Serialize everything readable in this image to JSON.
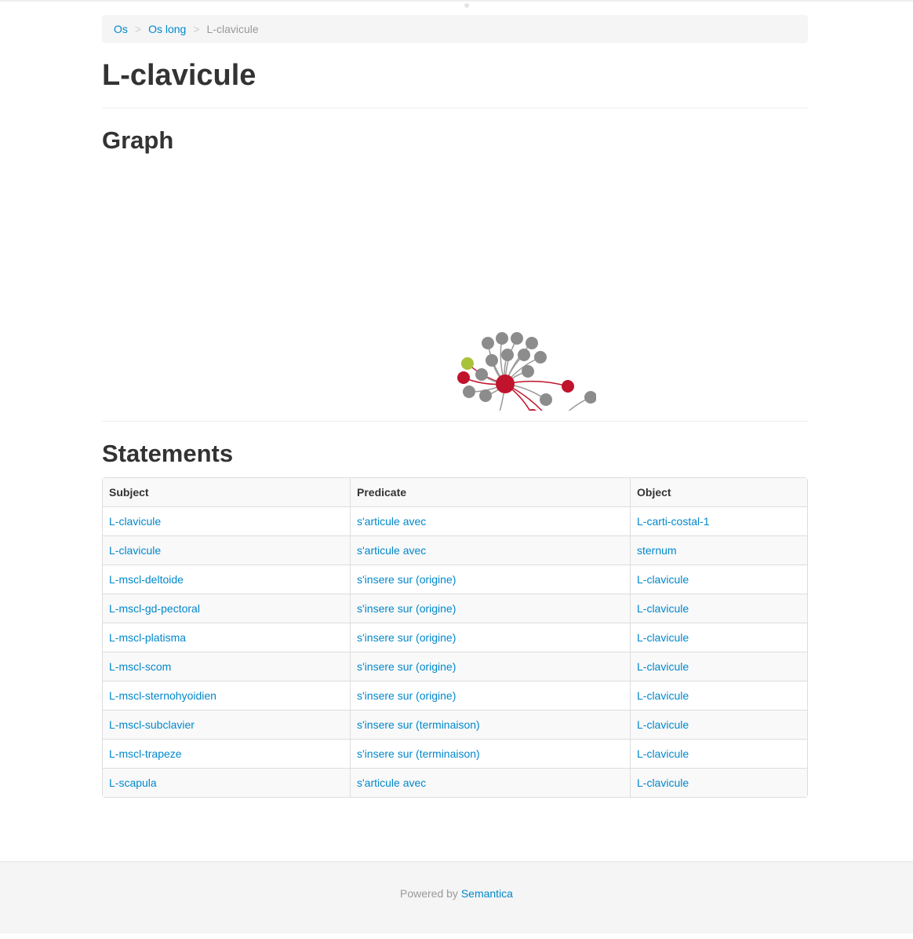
{
  "breadcrumb": {
    "items": [
      "Os",
      "Os long"
    ],
    "separator": ">",
    "current": "L-clavicule"
  },
  "page_title": "L-clavicule",
  "graph": {
    "title": "Graph",
    "colors": {
      "red": "#c0132c",
      "grey": "#8c8c8c",
      "yellow": "#cfbf3a",
      "lime": "#a8c23a",
      "black": "#000000",
      "pink": "#d93a5a"
    }
  },
  "statements": {
    "title": "Statements",
    "columns": [
      "Subject",
      "Predicate",
      "Object"
    ],
    "rows": [
      [
        "L-clavicule",
        "s'articule avec",
        "L-carti-costal-1"
      ],
      [
        "L-clavicule",
        "s'articule avec",
        "sternum"
      ],
      [
        "L-mscl-deltoide",
        "s'insere sur (origine)",
        "L-clavicule"
      ],
      [
        "L-mscl-gd-pectoral",
        "s'insere sur (origine)",
        "L-clavicule"
      ],
      [
        "L-mscl-platisma",
        "s'insere sur (origine)",
        "L-clavicule"
      ],
      [
        "L-mscl-scom",
        "s'insere sur (origine)",
        "L-clavicule"
      ],
      [
        "L-mscl-sternohyoidien",
        "s'insere sur (origine)",
        "L-clavicule"
      ],
      [
        "L-mscl-subclavier",
        "s'insere sur (terminaison)",
        "L-clavicule"
      ],
      [
        "L-mscl-trapeze",
        "s'insere sur (terminaison)",
        "L-clavicule"
      ],
      [
        "L-scapula",
        "s'articule avec",
        "L-clavicule"
      ]
    ]
  },
  "footer": {
    "prefix": "Powered by",
    "link": "Semantica"
  }
}
